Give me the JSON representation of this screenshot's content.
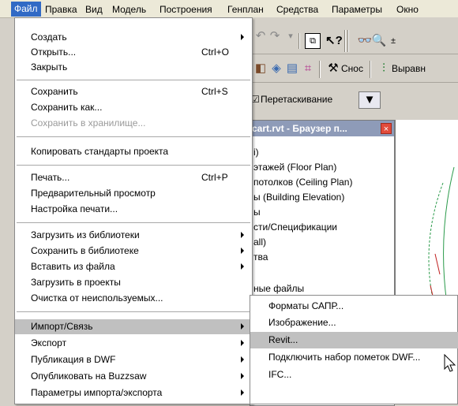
{
  "menubar": {
    "items": [
      "Файл",
      "Правка",
      "Вид",
      "Модель",
      "Построения",
      "Генплан",
      "Средства",
      "Параметры",
      "Окно"
    ]
  },
  "file_menu": {
    "items": [
      {
        "label": "Создать",
        "shortcut": "",
        "submenu": true,
        "disabled": false
      },
      {
        "label": "Открыть...",
        "shortcut": "Ctrl+O",
        "submenu": false,
        "disabled": false
      },
      {
        "label": "Закрыть",
        "shortcut": "",
        "submenu": false,
        "disabled": false
      },
      {
        "label": "Сохранить",
        "shortcut": "Ctrl+S",
        "submenu": false,
        "disabled": false
      },
      {
        "label": "Сохранить как...",
        "shortcut": "",
        "submenu": false,
        "disabled": false
      },
      {
        "label": "Сохранить в хранилище...",
        "shortcut": "",
        "submenu": false,
        "disabled": true
      },
      {
        "label": "Копировать стандарты проекта",
        "shortcut": "",
        "submenu": false,
        "disabled": false
      },
      {
        "label": "Печать...",
        "shortcut": "Ctrl+P",
        "submenu": false,
        "disabled": false
      },
      {
        "label": "Предварительный просмотр",
        "shortcut": "",
        "submenu": false,
        "disabled": false
      },
      {
        "label": "Настройка печати...",
        "shortcut": "",
        "submenu": false,
        "disabled": false
      },
      {
        "label": "Загрузить из библиотеки",
        "shortcut": "",
        "submenu": true,
        "disabled": false
      },
      {
        "label": "Сохранить в библиотеке",
        "shortcut": "",
        "submenu": true,
        "disabled": false
      },
      {
        "label": "Вставить из файла",
        "shortcut": "",
        "submenu": true,
        "disabled": false
      },
      {
        "label": "Загрузить в проекты",
        "shortcut": "",
        "submenu": false,
        "disabled": false
      },
      {
        "label": "Очистка от неиспользуемых...",
        "shortcut": "",
        "submenu": false,
        "disabled": false
      },
      {
        "label": "Импорт/Связь",
        "shortcut": "",
        "submenu": true,
        "disabled": false
      },
      {
        "label": "Экспорт",
        "shortcut": "",
        "submenu": true,
        "disabled": false
      },
      {
        "label": "Публикация в DWF",
        "shortcut": "",
        "submenu": true,
        "disabled": false
      },
      {
        "label": "Опубликовать на Buzzsaw",
        "shortcut": "",
        "submenu": true,
        "disabled": false
      },
      {
        "label": "Параметры импорта/экспорта",
        "shortcut": "",
        "submenu": true,
        "disabled": false
      }
    ]
  },
  "import_submenu": {
    "items": [
      "Форматы САПР...",
      "Изображение...",
      "Revit...",
      "Подключить набор пометок DWF...",
      "IFC..."
    ]
  },
  "toolbar": {
    "demolish_label": "Снос",
    "align_label": "Выравн",
    "drag_label": "Перетаскивание"
  },
  "browser": {
    "title": "cart.rvt - Браузер п...",
    "lines": [
      "i)",
      "этажей (Floor Plan)",
      "потолков (Ceiling Plan)",
      "ы (Building Elevation)",
      "ы",
      "сти/Спецификации",
      "all)",
      "тва",
      "ные файлы"
    ]
  },
  "colors": {
    "menu_active": "#316ac5",
    "highlight": "#c0c0c0",
    "browser_title": "#8e9bb8",
    "close_button": "#e24b3b"
  }
}
